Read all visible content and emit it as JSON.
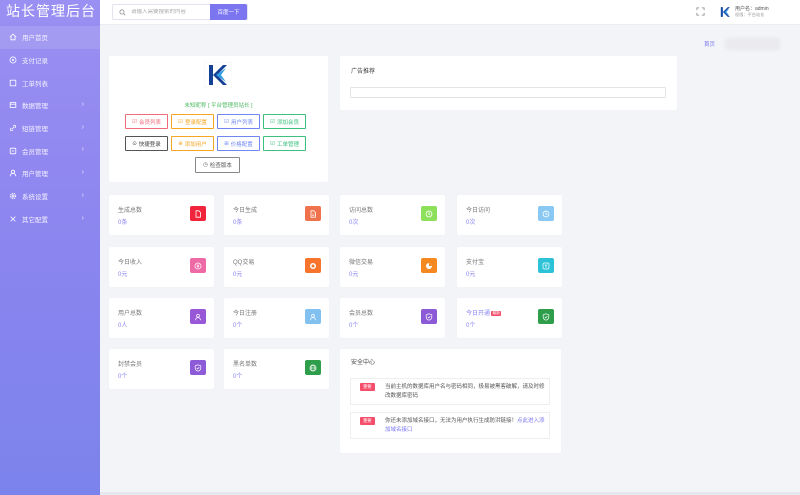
{
  "app": {
    "title": "站长管理后台"
  },
  "sidebar": {
    "items": [
      {
        "label": "用户首页",
        "icon": "home-icon",
        "has_arrow": false,
        "active": true
      },
      {
        "label": "支付记录",
        "icon": "record-icon",
        "has_arrow": false
      },
      {
        "label": "工单列表",
        "icon": "ticket-icon",
        "has_arrow": false
      },
      {
        "label": "数据管理",
        "icon": "data-icon",
        "has_arrow": true
      },
      {
        "label": "短链管理",
        "icon": "link-icon",
        "has_arrow": true
      },
      {
        "label": "会员管理",
        "icon": "member-icon",
        "has_arrow": true
      },
      {
        "label": "用户管理",
        "icon": "user-icon",
        "has_arrow": true
      },
      {
        "label": "系统设置",
        "icon": "gear-icon",
        "has_arrow": true
      },
      {
        "label": "其它配置",
        "icon": "config-icon",
        "has_arrow": true
      }
    ]
  },
  "topbar": {
    "search_placeholder": "请输入需要搜索的内容",
    "search_button": "百度一下",
    "user_name": "用户名：admin",
    "user_role": "权限：平台站长"
  },
  "breadcrumb": {
    "home": "首页"
  },
  "profile": {
    "nickname": "未知昵称 [ 平台管理员站长 ]",
    "buttons_row1": [
      {
        "label": "会员列表",
        "color": "#f06a7a",
        "icon": "member-list-icon",
        "glyph": "☑"
      },
      {
        "label": "登录配置",
        "color": "#f5a623",
        "icon": "login-config-icon",
        "glyph": "☑"
      },
      {
        "label": "用户列表",
        "color": "#6f86f3",
        "icon": "user-list-icon",
        "glyph": "☑"
      },
      {
        "label": "添加会员",
        "color": "#3cc07e",
        "icon": "add-member-icon",
        "glyph": "☑"
      }
    ],
    "buttons_row2": [
      {
        "label": "快捷登录",
        "color": "#555555",
        "icon": "quick-login-icon",
        "glyph": "⊙"
      },
      {
        "label": "添加用户",
        "color": "#f5a623",
        "icon": "add-user-icon",
        "glyph": "⊕"
      },
      {
        "label": "价格配置",
        "color": "#6f86f3",
        "icon": "cart-icon",
        "glyph": "⊞"
      },
      {
        "label": "工单管理",
        "color": "#3cc07e",
        "icon": "ticket-manage-icon",
        "glyph": "☑"
      }
    ],
    "version_button": "检查版本"
  },
  "ads": {
    "title": "广告推荐"
  },
  "stats": [
    {
      "label": "生成总数",
      "value": "0条",
      "color": "#f0243a",
      "icon": "file-icon"
    },
    {
      "label": "今日生成",
      "value": "0条",
      "color": "#f0724c",
      "icon": "file-icon"
    },
    {
      "label": "访问总数",
      "value": "0次",
      "color": "#8ce05a",
      "icon": "clock-icon"
    },
    {
      "label": "今日访问",
      "value": "0次",
      "color": "#88c8f2",
      "icon": "clock-icon"
    },
    {
      "label": "今日收入",
      "value": "0元",
      "color": "#ee6aa7",
      "icon": "yen-icon"
    },
    {
      "label": "QQ交易",
      "value": "0元",
      "color": "#f8742d",
      "icon": "qq-icon"
    },
    {
      "label": "微信交易",
      "value": "0元",
      "color": "#f5891f",
      "icon": "wechat-icon"
    },
    {
      "label": "支付宝",
      "value": "0元",
      "color": "#2ec2d8",
      "icon": "alipay-icon"
    },
    {
      "label": "用户总数",
      "value": "0人",
      "color": "#9757d7",
      "icon": "users-icon"
    },
    {
      "label": "今日注册",
      "value": "0个",
      "color": "#82c0f0",
      "icon": "users-icon"
    },
    {
      "label": "会员总数",
      "value": "0个",
      "color": "#8c5ad6",
      "icon": "shield-icon"
    },
    {
      "label": "今日开通",
      "value": "0个",
      "color": "#2f9e4b",
      "icon": "shield-icon",
      "badge": "最新"
    },
    {
      "label": "封禁会员",
      "value": "0个",
      "color": "#8e5bd8",
      "icon": "shield-icon"
    },
    {
      "label": "黑名单数",
      "value": "0个",
      "color": "#2f9e4b",
      "icon": "globe-icon"
    }
  ],
  "security": {
    "title": "安全中心",
    "items": [
      {
        "badge": "重要",
        "text": "当前主机的数据库用户名与密码相同，极易被黑客破解，请及时修改数据库密码",
        "link": ""
      },
      {
        "badge": "重要",
        "text": "你还未添加域名接口，无法为用户执行生成防洪链接！",
        "link": "点此进入添加域名接口"
      }
    ]
  }
}
